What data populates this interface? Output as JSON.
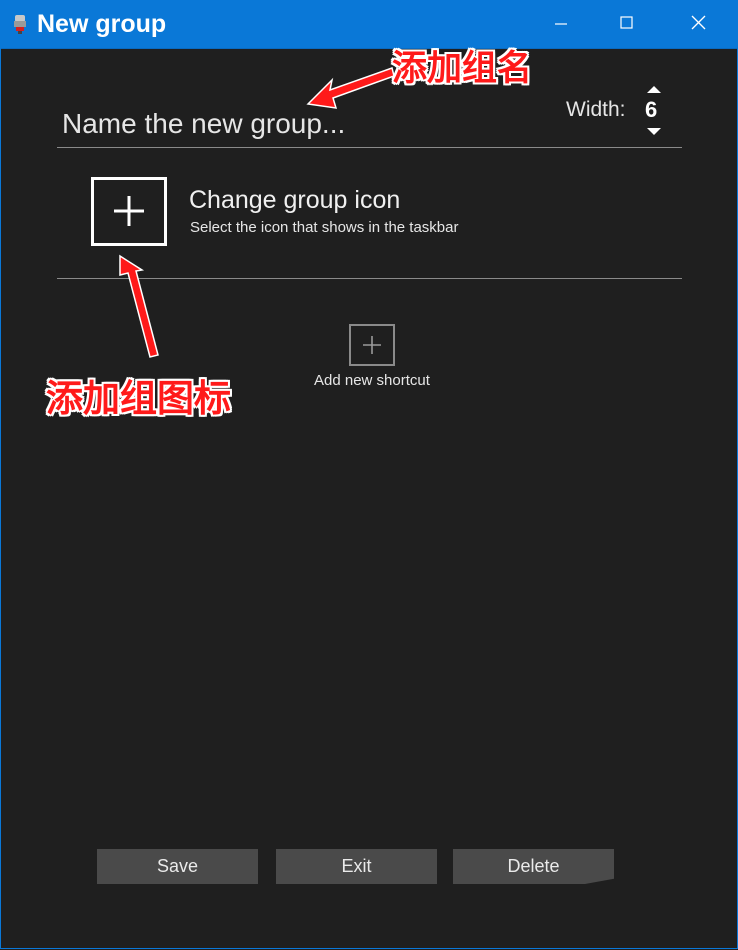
{
  "window": {
    "title": "New group",
    "icons": {
      "app": "app-icon",
      "minimize": "minimize-icon",
      "maximize": "maximize-icon",
      "close": "close-icon"
    }
  },
  "group_name": {
    "placeholder": "Name the new group...",
    "value": ""
  },
  "width": {
    "label": "Width:",
    "value": "6"
  },
  "group_icon": {
    "title": "Change group icon",
    "subtitle": "Select the icon that shows in the taskbar"
  },
  "shortcut": {
    "label": "Add new shortcut"
  },
  "buttons": {
    "save": "Save",
    "exit": "Exit",
    "delete": "Delete"
  },
  "annotations": {
    "name_hint": "添加组名",
    "icon_hint": "添加组图标"
  },
  "colors": {
    "titlebar": "#0a78d7",
    "background": "#1f1f1f",
    "button": "#4a4a4a",
    "annotation": "#ff1a1a"
  }
}
